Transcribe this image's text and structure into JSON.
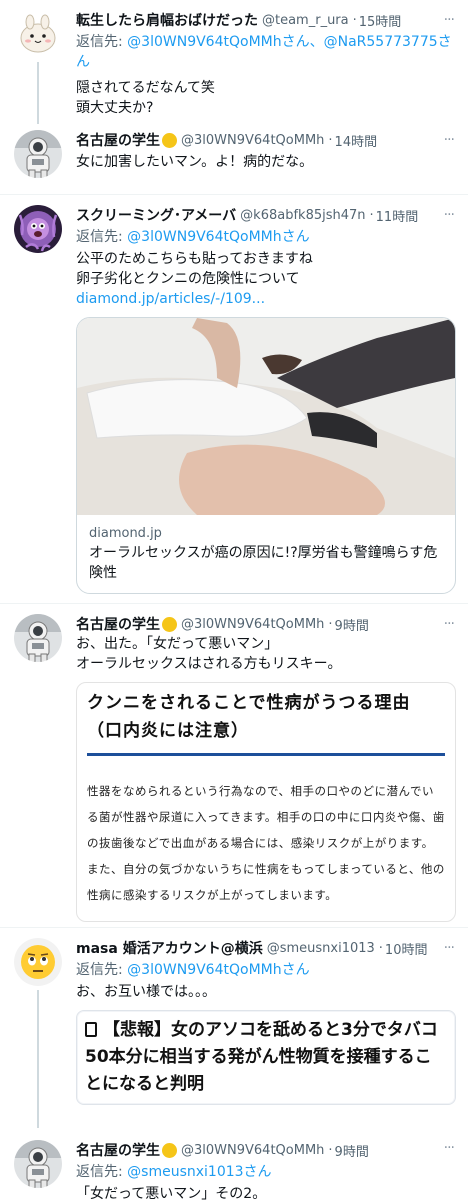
{
  "tweets": [
    {
      "name": "転生したら肩幅おばけだった",
      "handle": "@team_r_ura",
      "time": "15時間",
      "reply_prefix": "返信先: ",
      "reply_to": "@3l0WN9V64tQoMMhさん、@NaR55773775さん",
      "lines": [
        "隠されてるだなんて笑",
        "頭大丈夫か?"
      ]
    },
    {
      "name": "名古屋の学生",
      "handle": "@3l0WN9V64tQoMMh",
      "time": "14時間",
      "lines": [
        "女に加害したいマン。よ！病的だな。"
      ]
    },
    {
      "name": "スクリーミング･アメーバ",
      "handle": "@k68abfk85jsh47n",
      "time": "11時間",
      "reply_prefix": "返信先: ",
      "reply_to": "@3l0WN9V64tQoMMhさん",
      "lines": [
        "公平のためこちらも貼っておきますね",
        "卵子劣化とクンニの危険性について"
      ],
      "url": "diamond.jp/articles/-/109...",
      "card": {
        "domain": "diamond.jp",
        "title": "オーラルセックスが癌の原因に!?厚労省も警鐘鳴らす危険性"
      }
    },
    {
      "name": "名古屋の学生",
      "handle": "@3l0WN9V64tQoMMh",
      "time": "9時間",
      "lines": [
        "お、出た。「女だって悪いマン」",
        "オーラルセックスはされる方もリスキー。"
      ],
      "article": {
        "heading": "クンニをされることで性病がうつる理由（口内炎には注意）",
        "body": "性器をなめられるという行為なので、相手の口やのどに潜んでいる菌が性器や尿道に入ってきます。相手の口の中に口内炎や傷、歯の抜歯後などで出血がある場合には、感染リスクが上がります。また、自分の気づかないうちに性病をもってしまっていると、他の性病に感染するリスクが上がってしまいます。"
      }
    },
    {
      "name": "masa 婚活アカウント@横浜",
      "handle": "@smeusnxi1013",
      "time": "10時間",
      "reply_prefix": "返信先: ",
      "reply_to": "@3l0WN9V64tQoMMhさん",
      "lines": [
        "お、お互い様では。。。"
      ],
      "quote": {
        "title": "【悲報】女のアソコを舐めると3分でタバコ50本分に相当する発がん性物質を接種することになると判明"
      }
    },
    {
      "name": "名古屋の学生",
      "handle": "@3l0WN9V64tQoMMh",
      "time": "9時間",
      "reply_prefix": "返信先: ",
      "reply_to": "@smeusnxi1013さん",
      "lines": [
        "「女だって悪いマン」その2。"
      ]
    }
  ],
  "sep": "·",
  "more_glyph": "···",
  "colors": {
    "link": "#1d9bf0",
    "muted": "#536471",
    "thread": "#cfd9de"
  }
}
